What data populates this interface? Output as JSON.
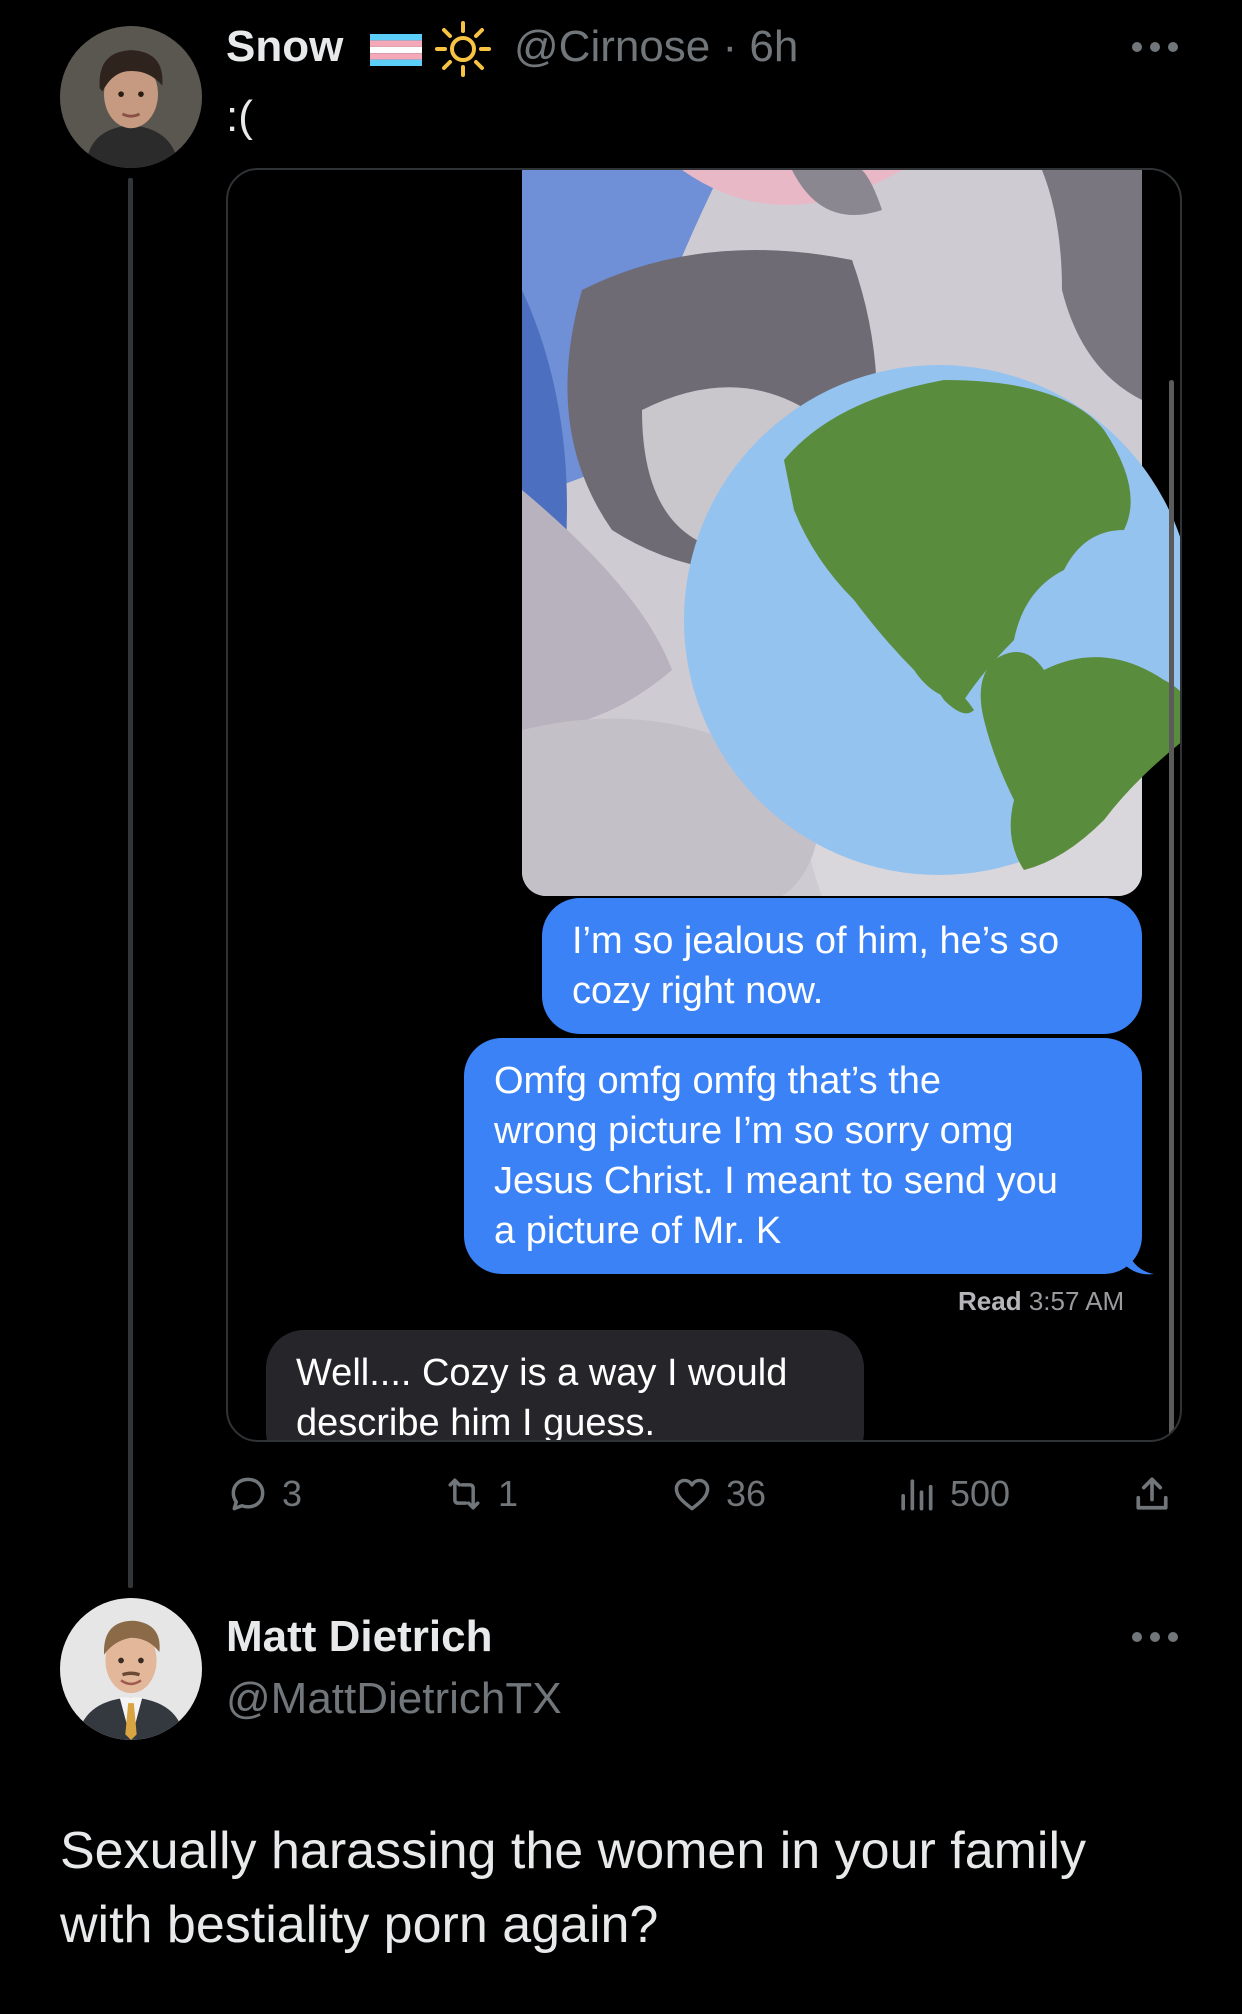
{
  "post": {
    "author_name": "Snow",
    "author_handle_time": "@Cirnose · 6h",
    "text": ":(",
    "media": {
      "messages": [
        {
          "lines": [
            "I’m so jealous of him, he’s so",
            "cozy right now."
          ]
        },
        {
          "lines": [
            "Omfg omfg omfg that’s the",
            "wrong picture I’m so sorry omg",
            "Jesus Christ. I meant to send you",
            "a picture of Mr. K"
          ]
        }
      ],
      "read_label": "Read",
      "read_time": "3:57 AM",
      "reply_lines": [
        "Well.... Cozy is a way I would",
        "describe him I guess."
      ]
    },
    "actions": {
      "replies": "3",
      "reposts": "1",
      "likes": "36",
      "views": "500"
    }
  },
  "reply": {
    "author_name": "Matt Dietrich",
    "author_handle": "@MattDietrichTX",
    "text_lines": [
      "Sexually harassing the women in your family",
      "with bestiality porn again?"
    ]
  },
  "colors": {
    "background": "#000000",
    "text_primary": "#e7e9ea",
    "text_secondary": "#71767b",
    "imessage_blue": "#3b82f6",
    "imessage_gray": "#26262a"
  },
  "icons": [
    "trans-flag-icon",
    "sun-icon",
    "more-icon",
    "reply-icon",
    "repost-icon",
    "like-icon",
    "views-icon",
    "share-icon",
    "globe-emoji-icon"
  ]
}
